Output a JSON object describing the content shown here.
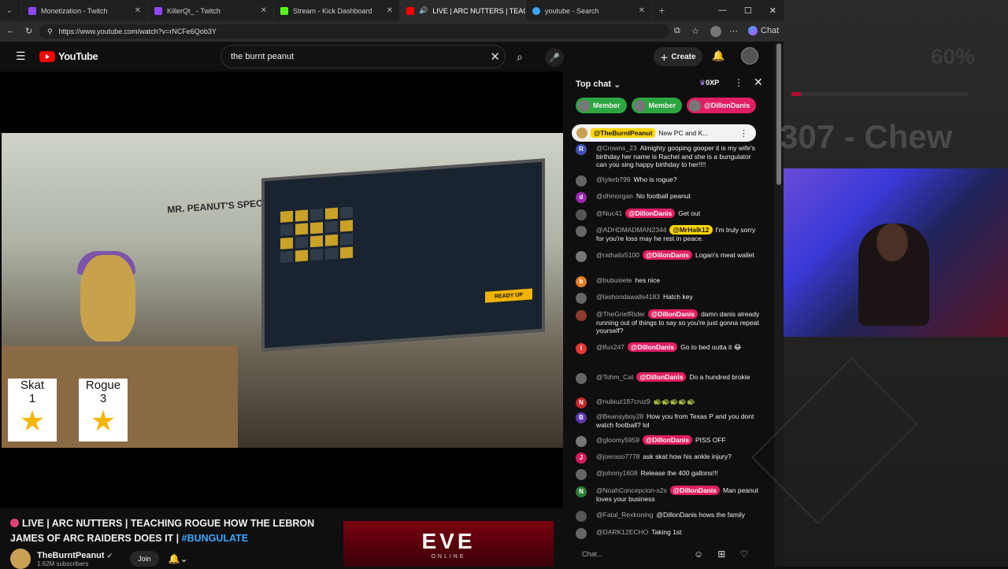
{
  "browser": {
    "tabs": [
      {
        "label": "Monetization - Twitch",
        "color": "#9146ff"
      },
      {
        "label": "KillerQt_ - Twitch",
        "color": "#9146ff"
      },
      {
        "label": "Stream - Kick Dashboard",
        "color": "#53fc18"
      },
      {
        "label": "LIVE | ARC NUTTERS | TEAC",
        "color": "#ff0000"
      },
      {
        "label": "youtube - Search",
        "color": "#3ea6ff"
      }
    ],
    "url": "https://www.youtube.com/watch?v=rNCFe6Qob3Y",
    "copilot_label": "Chat"
  },
  "youtube": {
    "search_query": "the burnt peanut",
    "create_label": "Create",
    "logo_text": "YouTube"
  },
  "video": {
    "scoreboard": [
      {
        "name": "Skat",
        "score": "1"
      },
      {
        "name": "Rogue",
        "score": "3"
      }
    ],
    "wall_sign": "MR. PEANUT'S SPECIAL ADULT LEARNING CENTER",
    "ready_label": "READY UP",
    "title_prefix": "LIVE | ARC NUTTERS | TEACHING ROGUE HOW THE LEBRON JAMES OF ARC RAIDERS DOES IT |",
    "hashtag": "#BUNGULATE",
    "channel": "TheBurntPeanut",
    "subscribers": "1.62M subscribers",
    "join_label": "Join"
  },
  "ad": {
    "brand": "EVE",
    "sub": "ONLINE"
  },
  "chat": {
    "mode_label": "Top chat",
    "xp_label": "0XP",
    "chips": [
      {
        "label": "Member",
        "bg": "#2ba640"
      },
      {
        "label": "Member",
        "bg": "#2ba640"
      },
      {
        "label": "@DillonDanis",
        "bg": "#e01e63"
      }
    ],
    "pinned": {
      "name": "@TheBurntPeanut",
      "text": "New PC and K..."
    },
    "messages": [
      {
        "initial": "R",
        "avc": "#3f51b5",
        "name": "@Crowns_23",
        "mention": "",
        "text": "Almighty gooping gooper it is my wife's birthday her name is Rachel and she is a bungulator can you sing happy birthday to her!!!!"
      },
      {
        "initial": "",
        "avc": "#666",
        "name": "@tylerb799",
        "mention": "",
        "text": "Who is rogue?"
      },
      {
        "initial": "d",
        "avc": "#9c27b0",
        "name": "@dhmorgan",
        "mention": "",
        "text": "No football peanut"
      },
      {
        "initial": "",
        "avc": "#555",
        "name": "@Nuc41",
        "mention": "@DillonDanis",
        "text": "Get out"
      },
      {
        "initial": "",
        "avc": "#666",
        "name": "@ADHDMADMAN2344",
        "mention": "@MrHalk12",
        "text": "I'm truly sorry for you're loss may he rest in peace."
      },
      {
        "initial": "",
        "avc": "#777",
        "name": "@rathalix5100",
        "mention": "@DillonDanis",
        "text": "Logan's meat wallet"
      },
      {
        "initial": "b",
        "avc": "#e67e22",
        "name": "@bubusiete",
        "mention": "",
        "text": "hes nice"
      },
      {
        "initial": "",
        "avc": "#666",
        "name": "@lashondawalls4183",
        "mention": "",
        "text": "Hatch key"
      },
      {
        "initial": "",
        "avc": "#8b3a2b",
        "name": "@TheGriefRider",
        "mention": "@DillonDanis",
        "text": "damn danis already running out of things to say so you're just gonna repeat yourself?"
      },
      {
        "initial": "I",
        "avc": "#e53935",
        "name": "@lfux247",
        "mention": "@DillonDanis",
        "text": "Go to bed outta it 😂"
      },
      {
        "initial": "",
        "avc": "#666",
        "name": "@Tohm_Cat",
        "mention": "@DillonDanis",
        "text": "Do a hundred brokie"
      },
      {
        "initial": "N",
        "avc": "#c62828",
        "name": "@nubiuz187cruz9",
        "mention": "",
        "text": "🐢🐢🐢🐢🐢"
      },
      {
        "initial": "B",
        "avc": "#5e35b1",
        "name": "@Beansyboy28",
        "mention": "",
        "text": "How you from Texas P and you dont watch football? lol"
      },
      {
        "initial": "",
        "avc": "#777",
        "name": "@gloomy5959",
        "mention": "@DillonDanis",
        "text": "PISS OFF"
      },
      {
        "initial": "J",
        "avc": "#d81b60",
        "name": "@joeraso7778",
        "mention": "",
        "text": "ask skat how his ankle injury?"
      },
      {
        "initial": "",
        "avc": "#666",
        "name": "@johnny1608",
        "mention": "",
        "text": "Release the 400 gallons!!!"
      },
      {
        "initial": "N",
        "avc": "#2e7d32",
        "name": "@NoahConcepcion-s2s",
        "mention": "@DillonDanis",
        "text": "Man peanut loves your business"
      },
      {
        "initial": "",
        "avc": "#555",
        "name": "@Fatal_Rexkoning",
        "mention": "",
        "text": "@DillonDanis hows the family"
      },
      {
        "initial": "",
        "avc": "#666",
        "name": "@DARK12ECHO",
        "mention": "",
        "text": "Taking 1st"
      }
    ],
    "input_placeholder": "Chat..."
  },
  "sidebar_overlay": {
    "percent": "60%",
    "label": "307 - Chew"
  }
}
